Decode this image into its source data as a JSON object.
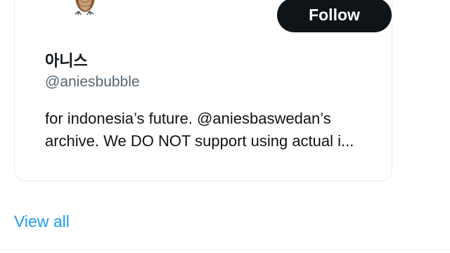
{
  "profile_card": {
    "avatar_icon": "owl-avatar-icon",
    "follow_label": "Follow",
    "display_name": "아니스",
    "handle": "@aniesbubble",
    "bio_line_1": "for indonesia’s future. @aniesbaswedan’s",
    "bio_line_2": "archive. We DO NOT support using actual i..."
  },
  "footer": {
    "view_all_label": "View all"
  },
  "colors": {
    "follow_button_bg": "#0f1419",
    "link": "#1d9bf0",
    "secondary_text": "#536471"
  }
}
